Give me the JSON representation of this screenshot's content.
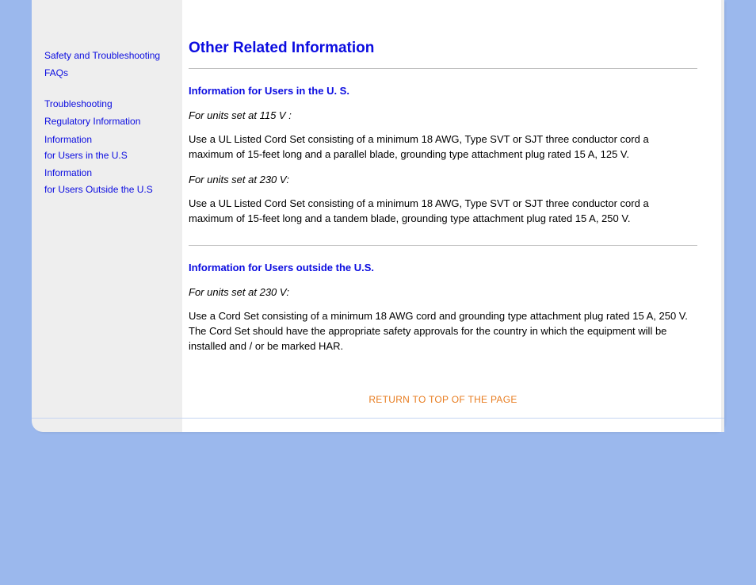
{
  "sidebar": {
    "links": [
      {
        "label": "Safety and Troubleshooting"
      },
      {
        "label": "FAQs"
      },
      {
        "label": "Troubleshooting"
      },
      {
        "label": "Regulatory Information"
      },
      {
        "label": "Information"
      },
      {
        "label": "for Users in the U.S"
      },
      {
        "label": "Information"
      },
      {
        "label": "for Users Outside the U.S"
      }
    ]
  },
  "main": {
    "title": "Other Related Information",
    "section1": {
      "heading": "Information for Users in the U. S.",
      "sub1_label": "For units set at 115 V :",
      "sub1_body": "Use a UL Listed Cord Set consisting of a minimum 18 AWG, Type SVT or SJT three conductor cord a maximum of 15-feet long and a parallel blade, grounding type attachment plug rated 15 A, 125 V.",
      "sub2_label": "For units set at 230 V:",
      "sub2_body": "Use a UL Listed Cord Set consisting of a minimum 18 AWG, Type SVT or SJT three conductor cord a maximum of 15-feet long and a tandem blade, grounding type attachment plug rated 15 A, 250 V."
    },
    "section2": {
      "heading": "Information for Users outside the U.S.",
      "sub1_label": "For units set at 230 V:",
      "sub1_body": "Use a Cord Set consisting of a minimum 18 AWG cord and grounding type attachment plug rated 15 A, 250 V. The Cord Set should have the appropriate safety approvals for the country in which the equipment will be installed and / or be marked HAR."
    },
    "return_label": "RETURN TO TOP OF THE PAGE"
  }
}
